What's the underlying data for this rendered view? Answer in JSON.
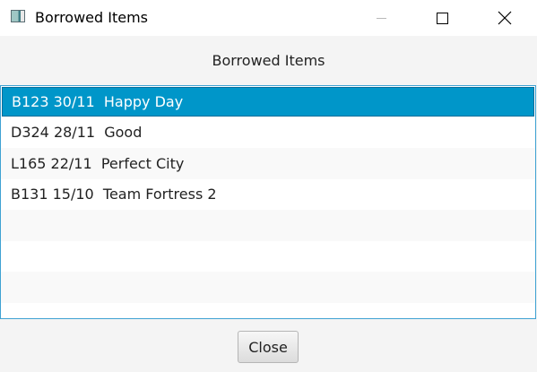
{
  "window": {
    "title": "Borrowed Items",
    "controls": {
      "minimize_icon": "minimize-icon",
      "maximize_icon": "maximize-icon",
      "close_icon": "close-icon"
    }
  },
  "header": {
    "label": "Borrowed Items"
  },
  "list": {
    "items": [
      {
        "text": "B123 30/11  Happy Day",
        "selected": true
      },
      {
        "text": "D324 28/11  Good",
        "selected": false
      },
      {
        "text": "L165 22/11  Perfect City",
        "selected": false
      },
      {
        "text": "B131 15/10  Team Fortress 2",
        "selected": false
      },
      {
        "text": "",
        "selected": false
      },
      {
        "text": "",
        "selected": false
      },
      {
        "text": "",
        "selected": false
      },
      {
        "text": "",
        "selected": false
      }
    ]
  },
  "footer": {
    "close_label": "Close"
  },
  "colors": {
    "selection": "#0096c9",
    "list_border": "#3fa2d3"
  }
}
